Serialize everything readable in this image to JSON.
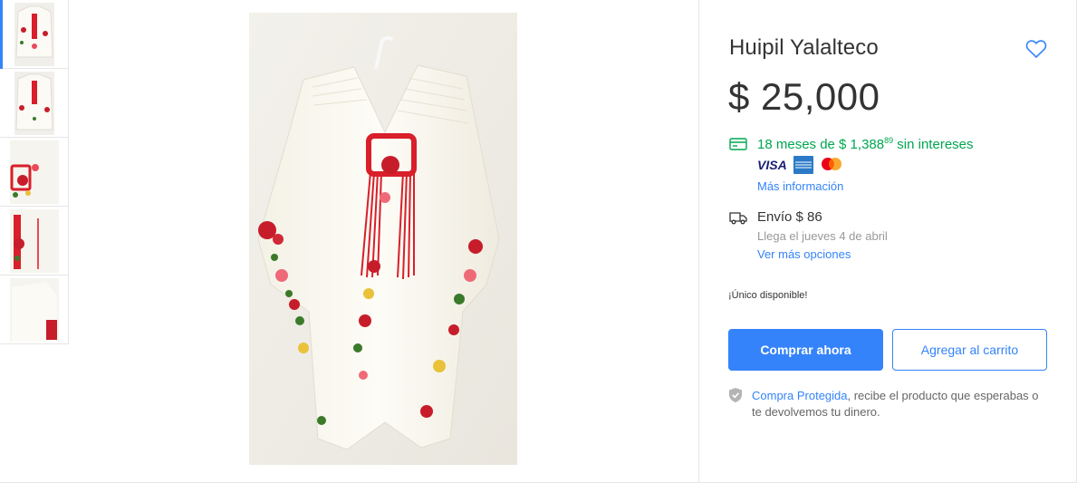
{
  "gallery": {
    "thumbnails": [
      {
        "name": "thumb-1",
        "active": true
      },
      {
        "name": "thumb-2",
        "active": false
      },
      {
        "name": "thumb-3",
        "active": false
      },
      {
        "name": "thumb-4",
        "active": false
      },
      {
        "name": "thumb-5",
        "active": false
      }
    ]
  },
  "product": {
    "title": "Huipil Yalalteco",
    "price": "$ 25,000"
  },
  "installments": {
    "text_prefix": "18 meses de $ 1,388",
    "cents": "89",
    "text_suffix": " sin intereses",
    "icon": "credit-card-icon",
    "cards": [
      "VISA",
      "American Express",
      "Mastercard"
    ],
    "more_info": "Más información"
  },
  "shipping": {
    "icon": "truck-icon",
    "label": "Envío $ 86",
    "arrival": "Llega el jueves 4 de abril",
    "more_options": "Ver más opciones"
  },
  "stock": "¡Único disponible!",
  "actions": {
    "buy_now": "Comprar ahora",
    "add_to_cart": "Agregar al carrito"
  },
  "protection": {
    "icon": "shield-check-icon",
    "link": "Compra Protegida",
    "text": ", recibe el producto que esperabas o te devolvemos tu dinero."
  },
  "colors": {
    "primary": "#3483fa",
    "green": "#00a650",
    "text": "#333333",
    "muted": "#999999"
  }
}
